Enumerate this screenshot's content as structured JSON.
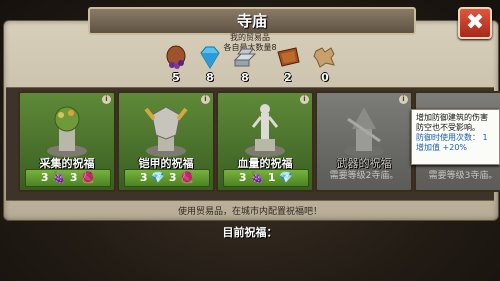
{
  "window": {
    "title": "寺庙",
    "close_label": "✖"
  },
  "goods": {
    "label_line1": "我的贸易品",
    "label_line2": "各自最大数量8",
    "items": [
      {
        "icon": "grape-sack-icon",
        "count": "5"
      },
      {
        "icon": "diamond-icon",
        "count": "8"
      },
      {
        "icon": "iron-ingot-icon",
        "count": "8"
      },
      {
        "icon": "leather-icon",
        "count": "2"
      },
      {
        "icon": "wool-icon",
        "count": "0"
      }
    ]
  },
  "blessings": [
    {
      "name": "采集的祝福",
      "cost": "3 🍇 3 🧶"
    },
    {
      "name": "铠甲的祝福",
      "cost": "3 💎 3 🧶"
    },
    {
      "name": "血量的祝福",
      "cost": "3 🍇 1 💎"
    },
    {
      "name": "武器的祝福",
      "requirement": "需要等级2寺庙。"
    },
    {
      "name": "",
      "requirement": "需要等级3寺庙。"
    }
  ],
  "tooltip": {
    "line1": "增加防御建筑的伤害",
    "line2": "防空也不受影响。",
    "line3": "防御时使用次数：",
    "line3_value": "1",
    "line4": "增加值",
    "line4_value": "+20%"
  },
  "hint": "使用贸易品，在城市内配置祝福吧！",
  "footer": "目前祝福："
}
